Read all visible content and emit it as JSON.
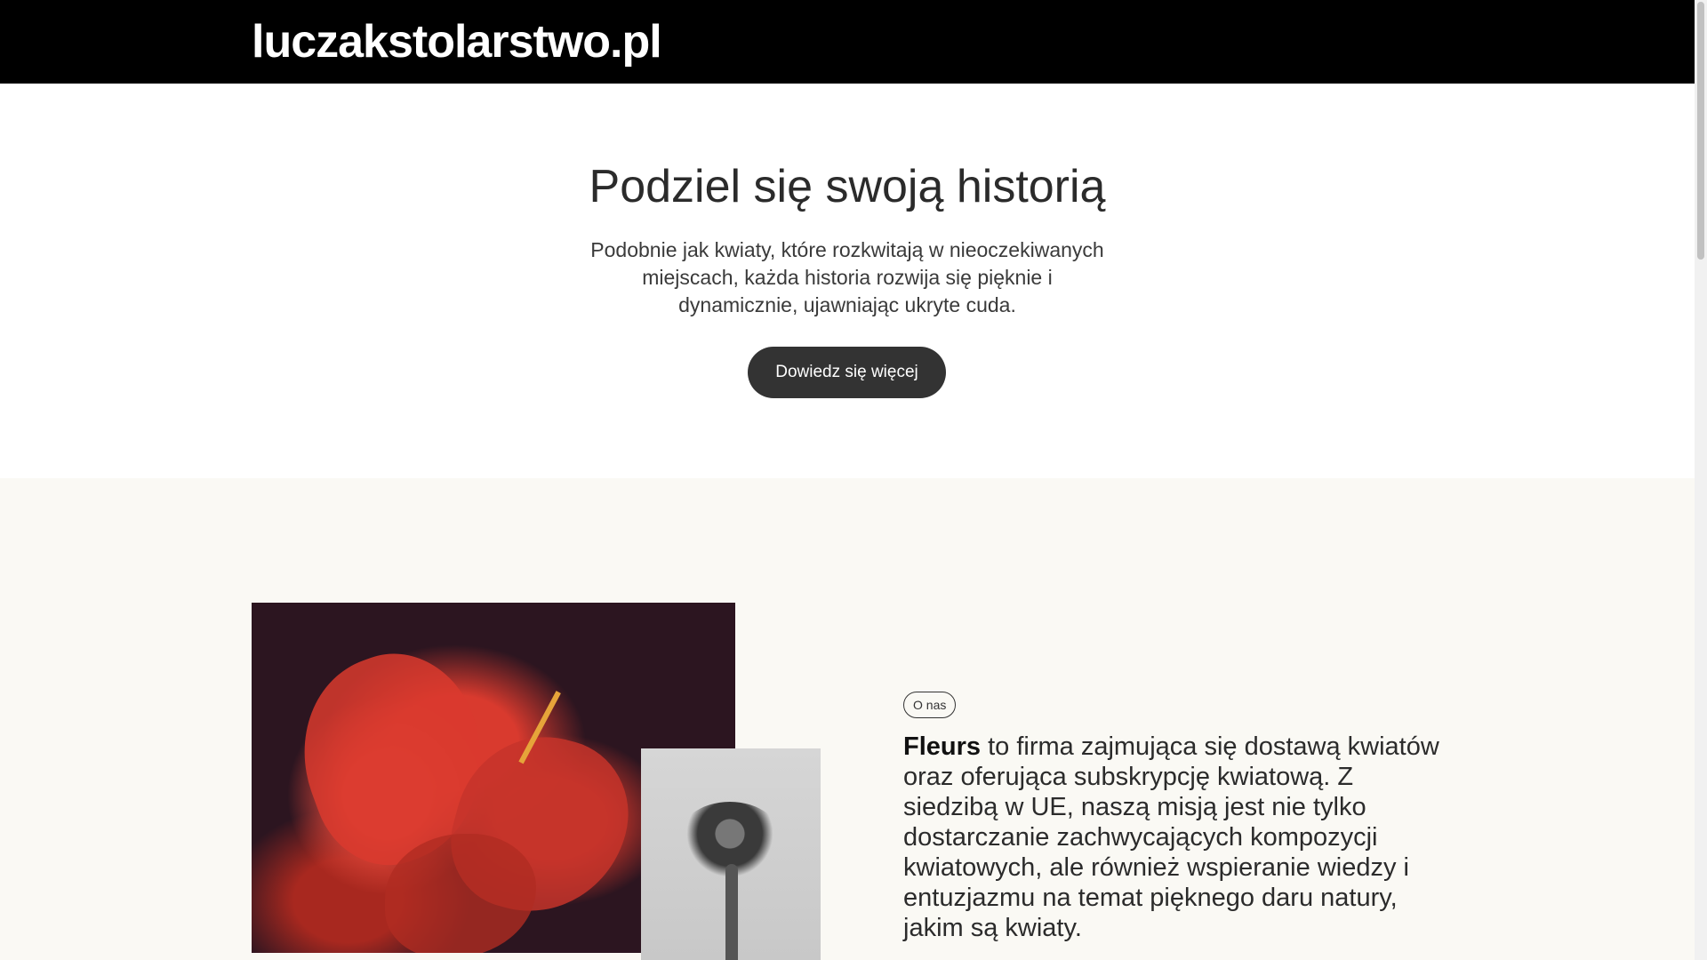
{
  "header": {
    "site_title": "luczakstolarstwo.pl"
  },
  "hero": {
    "title": "Podziel się swoją historią",
    "text": "Podobnie jak kwiaty, które rozkwitają w nieoczekiwanych miejscach, każda historia rozwija się pięknie i dynamicznie, ujawniając ukryte cuda.",
    "button_label": "Dowiedz się więcej"
  },
  "about": {
    "tag": "O nas",
    "brand": "Fleurs",
    "text": " to firma zajmująca się dostawą kwiatów oraz oferująca subskrypcję kwiatową. Z siedzibą w UE, naszą misją jest nie tylko dostarczanie zachwycających kompozycji kwiatowych, ale również wspieranie wiedzy i entuzjazmu na temat pięknego daru natury, jakim są kwiaty."
  },
  "colors": {
    "header_bg": "#000000",
    "button_bg": "#333333",
    "about_bg": "#faf9f4"
  }
}
